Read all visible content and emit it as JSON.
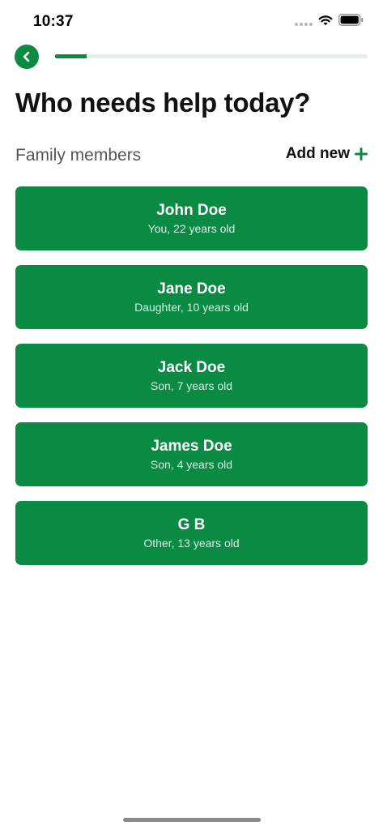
{
  "status_bar": {
    "time": "10:37"
  },
  "header": {
    "progress": 0.1
  },
  "title": "Who needs help today?",
  "section": {
    "label": "Family members",
    "add_new": "Add new"
  },
  "members": [
    {
      "name": "John Doe",
      "detail": "You, 22 years old"
    },
    {
      "name": "Jane Doe",
      "detail": "Daughter, 10 years old"
    },
    {
      "name": "Jack Doe",
      "detail": "Son, 7 years old"
    },
    {
      "name": "James Doe",
      "detail": "Son, 4 years old"
    },
    {
      "name": "G B",
      "detail": "Other, 13 years old"
    }
  ],
  "colors": {
    "accent": "#0a8a43",
    "track": "#e3efe8",
    "text": "#111111",
    "muted": "#555555"
  },
  "icons": {
    "back": "chevron-left-icon",
    "add": "plus-icon",
    "wifi": "wifi-icon",
    "battery": "battery-icon"
  }
}
